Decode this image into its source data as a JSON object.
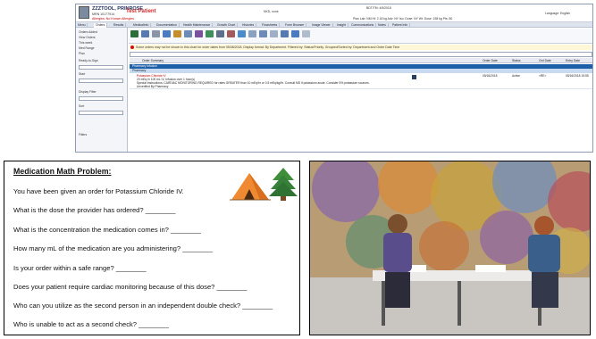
{
  "ehr": {
    "patient_name": "ZZZTOOL, PRINROSE",
    "patient_meta": "MRN 10177914",
    "allergies": "Allergies: No Known Allergies",
    "test_patient": "Test Patient",
    "info_line_1": "NKD, none",
    "info_line_2": "BDT/TM: 4/5/2018",
    "info_line_3": "Language: English",
    "info_line_4": "Plan Lab: NM  Ht: 2.18 kg  Adv: NY  Iso: Dose: NY  Wt: Dose: 158 kg  Pts: 80",
    "menu_tabs": [
      "Menu",
      "Orders",
      "Results",
      "MedicalInfo",
      "Documentation",
      "Health Maintenance",
      "Growth Chart",
      "Histories",
      "Flowsheets",
      "Form Browser",
      "Image Viewer",
      "Insight",
      "Communications",
      "Notes",
      "Patient Info"
    ],
    "side_lines": [
      "Orders Added",
      "View Orders",
      "This week",
      "Med Range",
      "Plan",
      "Ready-to-Sign",
      "Start",
      "Display Filter",
      "Sort",
      "Filters"
    ],
    "warning_text": "Some orders may not be shown in this chart for order dates from 05/08/2018. Display format: By Department. Filtered by: Status/Priority. Grouped/Sorted by: Department and Order Date Time",
    "grid_columns": [
      "Order Summary",
      "Order Date",
      "Status",
      "Ord Date",
      "Entry Date"
    ],
    "category_row": "Pharmacy Infusion",
    "subcategory_row": "Pharmacy",
    "order_line_1": "Potassium Chloride IV",
    "order_line_2": "20 mEq in 100 mL IV, Infusion over 1 hour(s)",
    "order_line_3": "Special Instructions: CARDIAC MONITORING REQUIRED for rates GREATER than 10 mEq/hr or 0.5 mEq/kg/hr. Consult MD if potassium acute. Consider 5% potassium sources.",
    "order_line_4": "Unverified By Pharmacy",
    "order_date": "05/16/2018",
    "order_status": "Active",
    "order_ord": "<RE>",
    "order_entry": "05/16/2018 15:55"
  },
  "worksheet": {
    "title": "Medication Math Problem:",
    "questions": [
      "You have been given an order for Potassium Chloride IV.",
      "What is the dose the provider has ordered? ________",
      "What is the concentration the medication comes in? ________",
      "How many mL of the medication are you administering? ________",
      "Is your order within a safe range? ________",
      "Does your patient require cardiac monitoring because of this dose? ________",
      "Who can you utilize as the second person in an independent double check? ________",
      "Who is unable to act as a second check? ________"
    ]
  },
  "colors": {
    "accent_blue": "#1d5fa8",
    "warning_red": "#c00000",
    "tent_orange": "#f08a32",
    "tree_green": "#3f8f3a"
  },
  "icons": [
    "camping-tent-icon",
    "tree-icon",
    "user-avatar-icon"
  ]
}
